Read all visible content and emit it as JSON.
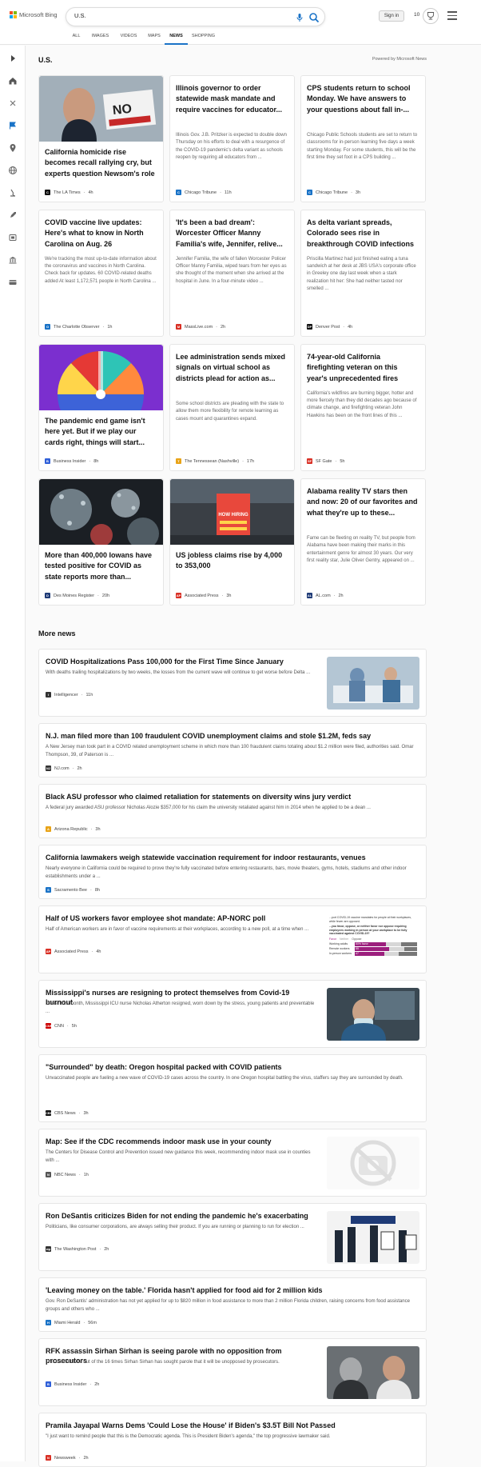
{
  "header": {
    "brand": "Microsoft Bing",
    "query": "U.S.",
    "signin": "Sign in",
    "points": "10",
    "tabs": [
      "ALL",
      "IMAGES",
      "VIDEOS",
      "MAPS",
      "NEWS",
      "SHOPPING"
    ],
    "active_tab": "NEWS"
  },
  "section": {
    "title": "U.S.",
    "powered_by": "Powered by Microsoft News"
  },
  "cards": [
    {
      "title": "California homicide rise becomes recall rallying cry, but experts question Newsom's role",
      "desc": "",
      "source": "The LA Times",
      "time": "4h",
      "logo": "C",
      "logo_color": "#111111"
    },
    {
      "title": "Illinois governor to order statewide mask mandate and require vaccines for educator...",
      "desc": "Illinois Gov. J.B. Pritzker is expected to double down Thursday on his efforts to deal with a resurgence of the COVID-19 pandemic's delta variant as schools reopen by requiring all educators from ...",
      "source": "Chicago Tribune",
      "time": "11h",
      "logo": "C",
      "logo_color": "#1a73c7"
    },
    {
      "title": "CPS students return to school Monday. We have answers to your questions about fall in-...",
      "desc": "Chicago Public Schools students are set to return to classrooms for in-person learning five days a week starting Monday. For some students, this will be the first time they set foot in a CPS building ...",
      "source": "Chicago Tribune",
      "time": "3h",
      "logo": "C",
      "logo_color": "#1a73c7"
    },
    {
      "title": "COVID vaccine live updates: Here's what to know in North Carolina on Aug. 26",
      "desc": "We're tracking the most up-to-date information about the coronavirus and vaccines in North Carolina. Check back for updates. 60 COVID-related deaths added At least 1,172,571 people in North Carolina ...",
      "source": "The Charlotte Observer",
      "time": "1h",
      "logo": "O",
      "logo_color": "#1a73c7"
    },
    {
      "title": "'It's been a bad dream': Worcester Officer Manny Familia's wife, Jennifer, relive...",
      "desc": "Jennifer Familia, the wife of fallen Worcester Policer Officer Manny Familia, wiped tears from her eyes as she thought of the moment when she arrived at the hospital in June. In a four-minute video ...",
      "source": "MassLive.com",
      "time": "2h",
      "logo": "M",
      "logo_color": "#d93025"
    },
    {
      "title": "As delta variant spreads, Colorado sees rise in breakthrough COVID infections",
      "desc": "Priscilla Martinez had just finished eating a tuna sandwich at her desk at JBS USA's corporate office in Greeley one day last week when a stark realization hit her: She had neither tasted nor smelled ...",
      "source": "Denver Post",
      "time": "4h",
      "logo": "DP",
      "logo_color": "#111111"
    },
    {
      "title": "The pandemic end game isn't here yet. But if we play our cards right, things will start...",
      "desc": "",
      "source": "Business Insider",
      "time": "8h",
      "logo": "B",
      "logo_color": "#2f5fd8"
    },
    {
      "title": "Lee administration sends mixed signals on virtual school as districts plead for action as...",
      "desc": "Some school districts are pleading with the state to allow them more flexibility for remote learning as cases mount and quarantines expand.",
      "source": "The Tennessean (Nashville)",
      "time": "17h",
      "logo": "T",
      "logo_color": "#e8a317"
    },
    {
      "title": "74-year-old California firefighting veteran on this year's unprecedented fires",
      "desc": "California's wildfires are burning bigger, hotter and more fiercely than they did decades ago because of climate change, and firefighting veteran John Hawkins has been on the front lines of this ...",
      "source": "SF Gate",
      "time": "5h",
      "logo": "SF",
      "logo_color": "#d93025"
    },
    {
      "title": "More than 400,000 Iowans have tested positive for COVID as state reports more than...",
      "desc": "",
      "source": "Des Moines Register",
      "time": "20h",
      "logo": "D",
      "logo_color": "#1f3b77"
    },
    {
      "title": "US jobless claims rise by 4,000 to 353,000",
      "desc": "",
      "source": "Associated Press",
      "time": "3h",
      "logo": "AP",
      "logo_color": "#d93025"
    },
    {
      "title": "Alabama reality TV stars then and now: 20 of our favorites and what they're up to these...",
      "desc": "Fame can be fleeting on reality TV, but people from Alabama have been making their marks in this entertainment genre for almost 30 years. Our very first reality star, Julie Oliver Gentry, appeared on ...",
      "source": "AL.com",
      "time": "2h",
      "logo": "AL",
      "logo_color": "#1f3b77"
    }
  ],
  "more_news": {
    "title": "More news",
    "items": [
      {
        "title": "COVID Hospitalizations Pass 100,000 for the First Time Since January",
        "desc": "With deaths trailing hospitalizations by two weeks, the losses from the current wave will continue to get worse before Delta ...",
        "source": "Intelligencer",
        "time": "11h",
        "logo": "I",
        "logo_color": "#333333"
      },
      {
        "title": "N.J. man filed more than 100 fraudulent COVID unemployment claims and stole $1.2M, feds say",
        "desc": "A New Jersey man took part in a COVID related unemployment scheme in which more than 100 fraudulent claims totaling about $1.2 million were filed, authorities said. Omar Thompson, 39, of Paterson is ...",
        "source": "NJ.com",
        "time": "2h",
        "logo": "NJ",
        "logo_color": "#333333"
      },
      {
        "title": "Black ASU professor who claimed retaliation for statements on diversity wins jury verdict",
        "desc": "A federal jury awarded ASU professor Nicholas Alozie $357,000 for his claim the university retaliated against him in 2014 when he applied to be a dean ...",
        "source": "Arizona Republic",
        "time": "3h",
        "logo": "A",
        "logo_color": "#e8a317"
      },
      {
        "title": "California lawmakers weigh statewide vaccination requirement for indoor restaurants, venues",
        "desc": "Nearly everyone in California could be required to prove they're fully vaccinated before entering restaurants, bars, movie theaters, gyms, hotels, stadiums and other indoor establishments under a ...",
        "source": "Sacramento Bee",
        "time": "8h",
        "logo": "S",
        "logo_color": "#1a73c7"
      },
      {
        "title": "Half of US workers favor employee shot mandate: AP-NORC poll",
        "desc": "Half of American workers are in favor of vaccine requirements at their workplaces, according to a new poll, at a time when ...",
        "source": "Associated Press",
        "time": "4h",
        "logo": "AP",
        "logo_color": "#d93025"
      },
      {
        "title": "Mississippi's nurses are resigning to protect themselves from Covid-19 burnout",
        "desc": "Earlier this month, Mississippi ICU nurse Nicholas Atherton resigned, worn down by the stress, young patients and preventable ...",
        "source": "CNN",
        "time": "5h",
        "logo": "CNN",
        "logo_color": "#cc0000"
      },
      {
        "title": "\"Surrounded\" by death: Oregon hospital packed with COVID patients",
        "desc": "Unvaccinated people are fueling a new wave of COVID-19 cases across the country. In one Oregon hospital battling the virus, staffers say they are surrounded by death.",
        "source": "CBS News",
        "time": "3h",
        "logo": "CBS",
        "logo_color": "#111111"
      },
      {
        "title": "Map: See if the CDC recommends indoor mask use in your county",
        "desc": "The Centers for Disease Control and Prevention issued new guidance this week, recommending indoor mask use in counties with ...",
        "source": "NBC News",
        "time": "1h",
        "logo": "N",
        "logo_color": "#555555"
      },
      {
        "title": "Ron DeSantis criticizes Biden for not ending the pandemic he's exacerbating",
        "desc": "Politicians, like consumer corporations, are always selling their product. If you are running or planning to run for election ...",
        "source": "The Washington Post",
        "time": "2h",
        "logo": "wp",
        "logo_color": "#333333"
      },
      {
        "title": "'Leaving money on the table.' Florida hasn't applied for food aid for 2 million kids",
        "desc": "Gov. Ron DeSantis' administration has not yet applied for up to $820 million in food assistance to more than 2 million Florida children, raising concerns from food assistance groups and others who ...",
        "source": "Miami Herald",
        "time": "56m",
        "logo": "H",
        "logo_color": "#1a73c7"
      },
      {
        "title": "RFK assassin Sirhan Sirhan is seeing parole with no opposition from prosecutors",
        "desc": "This the first time out of the 16 times Sirhan Sirhan has sought parole that it will be unopposed by prosecutors.",
        "source": "Business Insider",
        "time": "2h",
        "logo": "B",
        "logo_color": "#2f5fd8"
      },
      {
        "title": "Pramila Jayapal Warns Dems 'Could Lose the House' if Biden's $3.5T Bill Not Passed",
        "desc": "\"I just want to remind people that this is the Democratic agenda. This is President Biden's agenda,\" the top progressive lawmaker said.",
        "source": "Newsweek",
        "time": "2h",
        "logo": "N",
        "logo_color": "#d93025"
      }
    ]
  },
  "poll_thumb": {
    "question": "...port COVID-19 vaccine mandates for people at their workplaces, while fewer are opposed.",
    "subtext": "...you favor, oppose, or neither favor nor oppose requiring employees working in person at your workplace to be fully vaccinated against COVID-19?",
    "legend": [
      "Favor",
      "Neither",
      "Oppose"
    ],
    "rows": [
      {
        "label": "Working adults",
        "value": "50% favor"
      },
      {
        "label": "Remote workers",
        "value": "55"
      },
      {
        "label": "In-person workers",
        "value": "47"
      }
    ]
  },
  "hiring_sign": "HOW HIRING"
}
